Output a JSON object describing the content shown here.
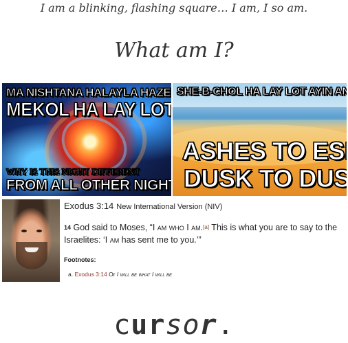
{
  "intro_line": "I am a blinking, flashing square… I am, I so am.",
  "question": "What am I?",
  "meme_left": {
    "top_line_1": "MA NISHTANA HALAYLA HAZEH",
    "top_line_2": "MEKOL HA LAY LOT",
    "bottom_line_1": "WHY IS THIS NIGHT DIFFERENT",
    "bottom_line_2": "FROM ALL OTHER NIGHTS?"
  },
  "meme_right": {
    "top_line": "SHE-B-CHOL HA LAY LOT AYIN ANU",
    "bottom_line_1": "ASHES TO ESH",
    "bottom_line_2": "DUSK TO DUST"
  },
  "bible": {
    "reference": "Exodus 3:14",
    "version": "New International Version (NIV)",
    "verse_number": "14",
    "verse_part1": "God said to Moses, “",
    "verse_sc1": "I am who I am",
    "verse_part2": ".",
    "footnote_marker": "[a]",
    "verse_part3": " This is what you are to say to the Israelites: ‘",
    "verse_sc2": "I am",
    "verse_part4": " has sent me to you.’”",
    "footnotes_label": "Footnotes:",
    "footnote_letter": "a.",
    "footnote_link": "Exodus 3:14",
    "footnote_or": " Or ",
    "footnote_sc": "I will be what I will be"
  },
  "cursor_word": {
    "part_plain": "c",
    "part_bold": "ur",
    "part_italic": "so",
    "part_bold2": "r",
    "period": "."
  }
}
